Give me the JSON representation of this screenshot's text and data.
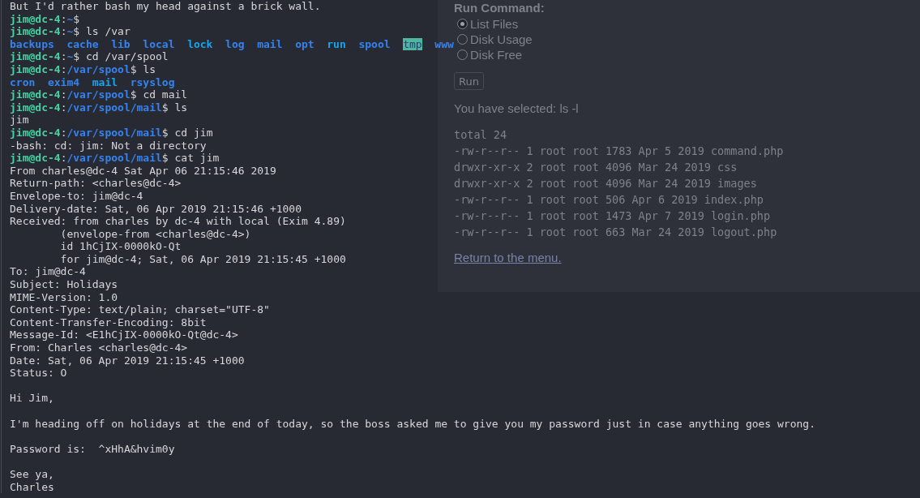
{
  "background_page": {
    "heading": "Run Command:",
    "radios": [
      {
        "label": "List Files",
        "selected": true
      },
      {
        "label": "Disk Usage",
        "selected": false
      },
      {
        "label": "Disk Free",
        "selected": false
      }
    ],
    "button": "Run",
    "selection_text": "You have selected: ls -l",
    "listing": [
      "total 24",
      "-rw-r--r-- 1 root root 1783 Apr 5 2019 command.php",
      "drwxr-xr-x 2 root root 4096 Mar 24 2019 css",
      "drwxr-xr-x 2 root root 4096 Mar 24 2019 images",
      "-rw-r--r-- 1 root root 506 Apr 6 2019 index.php",
      "-rw-r--r-- 1 root root 1473 Apr 7 2019 login.php",
      "-rw-r--r-- 1 root root 663 Mar 24 2019 logout.php"
    ],
    "link": "Return to the menu."
  },
  "terminal": {
    "lines": [
      {
        "kind": "text",
        "segments": [
          {
            "kind": "plain",
            "text": "But I'd rather bash my head against a brick wall."
          }
        ]
      },
      {
        "kind": "text",
        "segments": [
          {
            "kind": "user",
            "text": "jim@dc-4"
          },
          {
            "kind": "plain",
            "text": ":"
          },
          {
            "kind": "path",
            "text": "~"
          },
          {
            "kind": "plain",
            "text": "$"
          }
        ]
      },
      {
        "kind": "text",
        "segments": [
          {
            "kind": "user",
            "text": "jim@dc-4"
          },
          {
            "kind": "plain",
            "text": ":"
          },
          {
            "kind": "path",
            "text": "~"
          },
          {
            "kind": "plain",
            "text": "$ ls /var"
          }
        ]
      },
      {
        "kind": "listing",
        "entries": [
          {
            "kind": "dir",
            "text": "backups"
          },
          {
            "kind": "dir",
            "text": "cache"
          },
          {
            "kind": "dir",
            "text": "lib"
          },
          {
            "kind": "dir",
            "text": "local"
          },
          {
            "kind": "link",
            "text": "lock"
          },
          {
            "kind": "dir",
            "text": "log"
          },
          {
            "kind": "dir",
            "text": "mail"
          },
          {
            "kind": "dir",
            "text": "opt"
          },
          {
            "kind": "link",
            "text": "run"
          },
          {
            "kind": "dir",
            "text": "spool"
          },
          {
            "kind": "sticky",
            "text": "tmp"
          },
          {
            "kind": "dir",
            "text": "www"
          }
        ]
      },
      {
        "kind": "text",
        "segments": [
          {
            "kind": "user",
            "text": "jim@dc-4"
          },
          {
            "kind": "plain",
            "text": ":"
          },
          {
            "kind": "path",
            "text": "~"
          },
          {
            "kind": "plain",
            "text": "$ cd /var/spool"
          }
        ]
      },
      {
        "kind": "text",
        "segments": [
          {
            "kind": "user",
            "text": "jim@dc-4"
          },
          {
            "kind": "plain",
            "text": ":"
          },
          {
            "kind": "path",
            "text": "/var/spool"
          },
          {
            "kind": "plain",
            "text": "$ ls"
          }
        ]
      },
      {
        "kind": "listing",
        "entries": [
          {
            "kind": "dir",
            "text": "cron"
          },
          {
            "kind": "dir",
            "text": "exim4"
          },
          {
            "kind": "link",
            "text": "mail"
          },
          {
            "kind": "dir",
            "text": "rsyslog"
          }
        ]
      },
      {
        "kind": "text",
        "segments": [
          {
            "kind": "user",
            "text": "jim@dc-4"
          },
          {
            "kind": "plain",
            "text": ":"
          },
          {
            "kind": "path",
            "text": "/var/spool"
          },
          {
            "kind": "plain",
            "text": "$ cd mail"
          }
        ]
      },
      {
        "kind": "text",
        "segments": [
          {
            "kind": "user",
            "text": "jim@dc-4"
          },
          {
            "kind": "plain",
            "text": ":"
          },
          {
            "kind": "path",
            "text": "/var/spool/mail"
          },
          {
            "kind": "plain",
            "text": "$ ls"
          }
        ]
      },
      {
        "kind": "text",
        "segments": [
          {
            "kind": "plain",
            "text": "jim"
          }
        ]
      },
      {
        "kind": "text",
        "segments": [
          {
            "kind": "user",
            "text": "jim@dc-4"
          },
          {
            "kind": "plain",
            "text": ":"
          },
          {
            "kind": "path",
            "text": "/var/spool/mail"
          },
          {
            "kind": "plain",
            "text": "$ cd jim"
          }
        ]
      },
      {
        "kind": "text",
        "segments": [
          {
            "kind": "plain",
            "text": "-bash: cd: jim: Not a directory"
          }
        ]
      },
      {
        "kind": "text",
        "segments": [
          {
            "kind": "user",
            "text": "jim@dc-4"
          },
          {
            "kind": "plain",
            "text": ":"
          },
          {
            "kind": "path",
            "text": "/var/spool/mail"
          },
          {
            "kind": "plain",
            "text": "$ cat jim"
          }
        ]
      },
      {
        "kind": "text",
        "segments": [
          {
            "kind": "plain",
            "text": "From charles@dc-4 Sat Apr 06 21:15:46 2019"
          }
        ]
      },
      {
        "kind": "text",
        "segments": [
          {
            "kind": "plain",
            "text": "Return-path: <charles@dc-4>"
          }
        ]
      },
      {
        "kind": "text",
        "segments": [
          {
            "kind": "plain",
            "text": "Envelope-to: jim@dc-4"
          }
        ]
      },
      {
        "kind": "text",
        "segments": [
          {
            "kind": "plain",
            "text": "Delivery-date: Sat, 06 Apr 2019 21:15:46 +1000"
          }
        ]
      },
      {
        "kind": "text",
        "segments": [
          {
            "kind": "plain",
            "text": "Received: from charles by dc-4 with local (Exim 4.89)"
          }
        ]
      },
      {
        "kind": "text",
        "segments": [
          {
            "kind": "plain",
            "text": "        (envelope-from <charles@dc-4>)"
          }
        ]
      },
      {
        "kind": "text",
        "segments": [
          {
            "kind": "plain",
            "text": "        id 1hCjIX-0000kO-Qt"
          }
        ]
      },
      {
        "kind": "text",
        "segments": [
          {
            "kind": "plain",
            "text": "        for jim@dc-4; Sat, 06 Apr 2019 21:15:45 +1000"
          }
        ]
      },
      {
        "kind": "text",
        "segments": [
          {
            "kind": "plain",
            "text": "To: jim@dc-4"
          }
        ]
      },
      {
        "kind": "text",
        "segments": [
          {
            "kind": "plain",
            "text": "Subject: Holidays"
          }
        ]
      },
      {
        "kind": "text",
        "segments": [
          {
            "kind": "plain",
            "text": "MIME-Version: 1.0"
          }
        ]
      },
      {
        "kind": "text",
        "segments": [
          {
            "kind": "plain",
            "text": "Content-Type: text/plain; charset=\"UTF-8\""
          }
        ]
      },
      {
        "kind": "text",
        "segments": [
          {
            "kind": "plain",
            "text": "Content-Transfer-Encoding: 8bit"
          }
        ]
      },
      {
        "kind": "text",
        "segments": [
          {
            "kind": "plain",
            "text": "Message-Id: <E1hCjIX-0000kO-Qt@dc-4>"
          }
        ]
      },
      {
        "kind": "text",
        "segments": [
          {
            "kind": "plain",
            "text": "From: Charles <charles@dc-4>"
          }
        ]
      },
      {
        "kind": "text",
        "segments": [
          {
            "kind": "plain",
            "text": "Date: Sat, 06 Apr 2019 21:15:45 +1000"
          }
        ]
      },
      {
        "kind": "text",
        "segments": [
          {
            "kind": "plain",
            "text": "Status: O"
          }
        ]
      },
      {
        "kind": "blank"
      },
      {
        "kind": "text",
        "segments": [
          {
            "kind": "plain",
            "text": "Hi Jim,"
          }
        ]
      },
      {
        "kind": "blank"
      },
      {
        "kind": "text",
        "segments": [
          {
            "kind": "plain",
            "text": "I'm heading off on holidays at the end of today, so the boss asked me to give you my password just in case anything goes wrong."
          }
        ]
      },
      {
        "kind": "blank"
      },
      {
        "kind": "text",
        "segments": [
          {
            "kind": "plain",
            "text": "Password is:  ^xHhA&hvim0y"
          }
        ]
      },
      {
        "kind": "blank"
      },
      {
        "kind": "text",
        "segments": [
          {
            "kind": "plain",
            "text": "See ya,"
          }
        ]
      },
      {
        "kind": "text",
        "segments": [
          {
            "kind": "plain",
            "text": "Charles"
          }
        ]
      }
    ]
  }
}
